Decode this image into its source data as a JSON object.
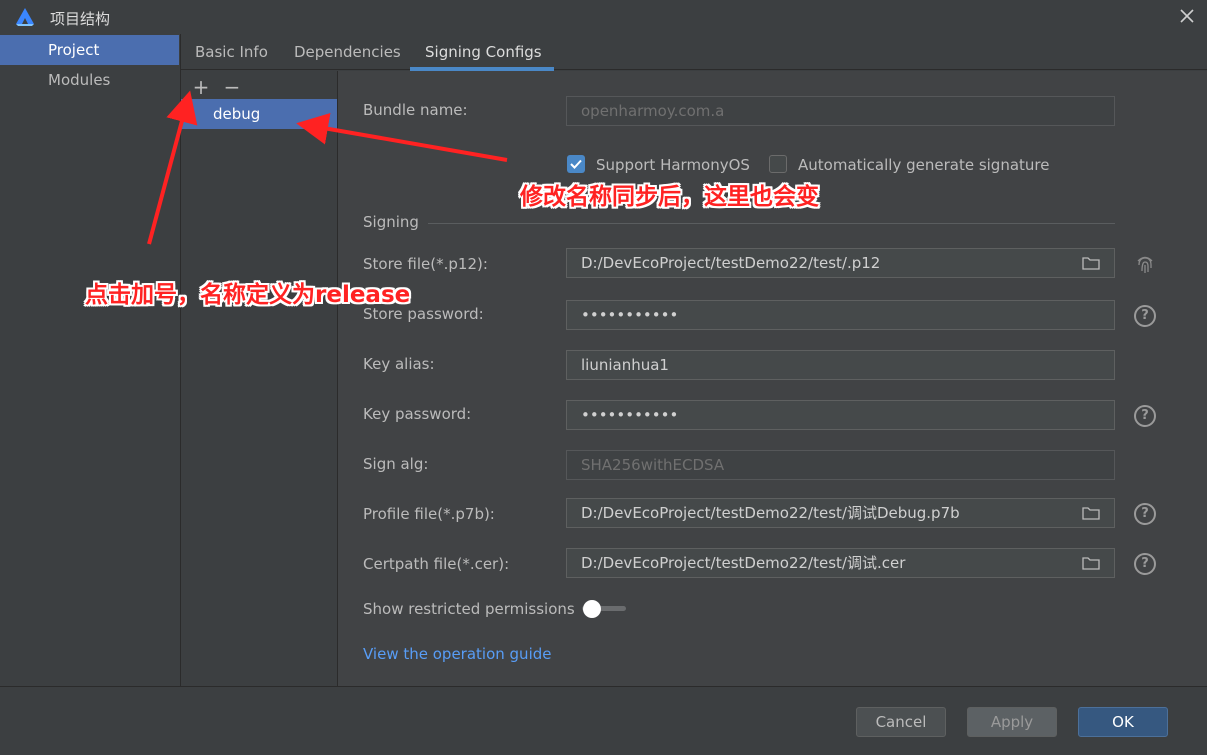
{
  "window": {
    "title": "项目结构",
    "close_icon": "close-icon"
  },
  "nav": {
    "items": [
      {
        "label": "Project",
        "selected": true
      },
      {
        "label": "Modules",
        "selected": false
      }
    ]
  },
  "tabs": [
    {
      "label": "Basic Info"
    },
    {
      "label": "Dependencies"
    },
    {
      "label": "Signing Configs",
      "active": true
    }
  ],
  "configs": {
    "add_symbol": "+",
    "remove_symbol": "−",
    "items": [
      "debug"
    ]
  },
  "form": {
    "bundle_name": {
      "label": "Bundle name:",
      "placeholder": "openharmoy.com.a"
    },
    "support_harmonyos": {
      "label": "Support HarmonyOS",
      "checked": true
    },
    "auto_signature": {
      "label": "Automatically generate signature",
      "checked": false
    },
    "signing_section": "Signing",
    "store_file": {
      "label": "Store file(*.p12):",
      "value": "D:/DevEcoProject/testDemo22/test/.p12"
    },
    "store_password": {
      "label": "Store password:",
      "value": "•••••••••••"
    },
    "key_alias": {
      "label": "Key alias:",
      "value": "liunianhua1"
    },
    "key_password": {
      "label": "Key password:",
      "value": "•••••••••••"
    },
    "sign_alg": {
      "label": "Sign alg:",
      "value": "SHA256withECDSA"
    },
    "profile_file": {
      "label": "Profile file(*.p7b):",
      "value": "D:/DevEcoProject/testDemo22/test/调试Debug.p7b"
    },
    "certpath_file": {
      "label": "Certpath file(*.cer):",
      "value": "D:/DevEcoProject/testDemo22/test/调试.cer"
    },
    "restricted_permissions": {
      "label": "Show restricted permissions",
      "on": false
    },
    "guide_link": "View the operation guide",
    "help_symbol": "?"
  },
  "buttons": {
    "cancel": "Cancel",
    "apply": "Apply",
    "ok": "OK"
  },
  "annotations": {
    "rename_note": "修改名称同步后，这里也会变",
    "add_note": "点击加号，名称定义为release"
  },
  "colors": {
    "accent": "#4b6eaf",
    "link": "#589df6",
    "annotation": "#ff2222"
  }
}
